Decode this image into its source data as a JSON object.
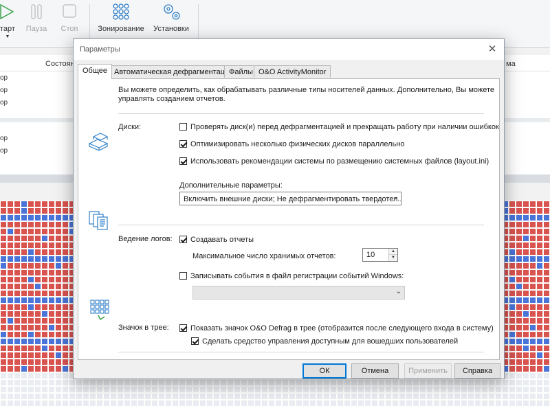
{
  "toolbar": {
    "start_label": "тарт",
    "pause_label": "Пауза",
    "stop_label": "Стоп",
    "zoning_label": "Зонирование",
    "settings_label": "Установки"
  },
  "list": {
    "col_status": "Состоян",
    "col_right": "ма",
    "row_fragments": [
      "ор",
      "ор",
      "ор",
      "ор",
      "ор"
    ]
  },
  "cluster_map": {
    "colors": {
      "red": "#d9534f",
      "blue": "#4a74d8",
      "empty": "#e9ecf0"
    }
  },
  "dialog": {
    "title": "Параметры",
    "close_glyph": "✕",
    "tabs": [
      {
        "label": "Общее",
        "active": true
      },
      {
        "label": "Автоматическая дефрагментация",
        "active": false
      },
      {
        "label": "Файлы",
        "active": false
      },
      {
        "label": "O&O ActivityMonitor",
        "active": false
      }
    ],
    "intro_line1": "Вы можете определить, как обрабатывать различные типы носителей данных. Дополнительно, Вы можете",
    "intro_line2": "управлять созданием отчетов.",
    "disks": {
      "label": "Диски:",
      "check_errors": {
        "label": "Проверять диск(и) перед дефрагментацией и прекращать работу при наличии ошибкок",
        "checked": false
      },
      "optimize_parallel": {
        "label": "Оптимизировать несколько физических дисков параллельно",
        "checked": true
      },
      "use_layout": {
        "label": "Использовать рекомендации системы по размещению системных файлов (layout.ini)",
        "checked": true
      },
      "extra_label": "Дополнительные параметры:",
      "extra_value": "Включить внешние диски; Не дефрагментировать твердотел..."
    },
    "logging": {
      "label": "Ведение логов:",
      "create_reports": {
        "label": "Создавать отчеты",
        "checked": true
      },
      "max_reports_label": "Максимальное число хранимых отчетов:",
      "max_reports_value": "10",
      "write_events": {
        "label": "Записывать события в файл регистрации событий Windows:",
        "checked": false
      },
      "event_level_value": ""
    },
    "tray": {
      "label": "Значок в трее:",
      "show_icon": {
        "label": "Показать значок O&O Defrag в трее (отобразится после следующего входа в систему)",
        "checked": true
      },
      "for_all_users": {
        "label": "Сделать средство управления доступным для вошедших пользователей",
        "checked": true
      }
    },
    "buttons": {
      "ok": "ОК",
      "cancel": "Отмена",
      "apply": "Применить",
      "help": "Справка"
    }
  },
  "colors": {
    "accent": "#0078d7",
    "icon_blue": "#2f7fc9",
    "icon_green": "#3aa24a"
  }
}
